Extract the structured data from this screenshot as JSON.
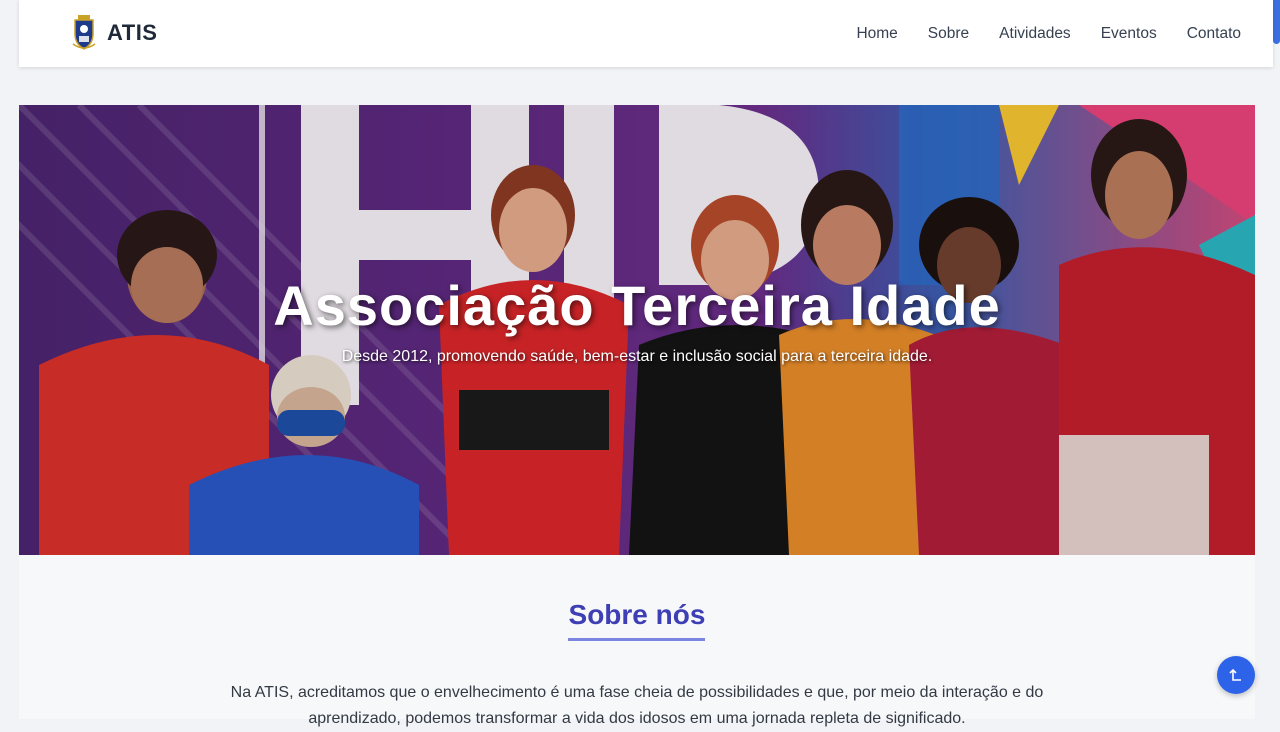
{
  "brand": {
    "name": "ATIS",
    "logo_icon": "crest-logo-icon"
  },
  "nav": {
    "items": [
      {
        "label": "Home"
      },
      {
        "label": "Sobre"
      },
      {
        "label": "Atividades"
      },
      {
        "label": "Eventos"
      },
      {
        "label": "Contato"
      }
    ]
  },
  "hero": {
    "title": "Associação Terceira Idade",
    "subtitle": "Desde 2012, promovendo saúde, bem-estar e inclusão social para a terceira idade."
  },
  "about": {
    "title": "Sobre nós",
    "text": "Na ATIS, acreditamos que o envelhecimento é uma fase cheia de possibilidades e que, por meio da interação e do aprendizado, podemos transformar a vida dos idosos em uma jornada repleta de significado."
  },
  "back_to_top": {
    "icon": "arrow-up-icon"
  },
  "colors": {
    "accent": "#3f3fb5",
    "button": "#2c63e8",
    "underline": "#7b85e0"
  }
}
